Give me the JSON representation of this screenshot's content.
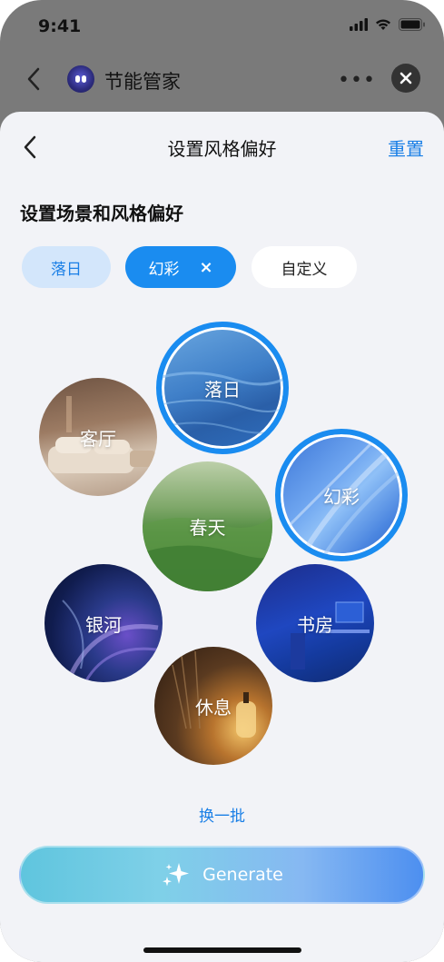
{
  "status_bar": {
    "time": "9:41"
  },
  "app_header": {
    "title": "节能管家"
  },
  "sheet": {
    "title": "设置风格偏好",
    "reset_label": "重置",
    "section_title": "设置场景和风格偏好",
    "chips": [
      {
        "label": "落日",
        "state": "selected-light"
      },
      {
        "label": "幻彩",
        "state": "active",
        "remove": "×"
      },
      {
        "label": "自定义",
        "state": "default"
      }
    ],
    "bubbles": [
      {
        "label": "落日",
        "selected": true
      },
      {
        "label": "客厅",
        "selected": false
      },
      {
        "label": "幻彩",
        "selected": true
      },
      {
        "label": "春天",
        "selected": false
      },
      {
        "label": "银河",
        "selected": false
      },
      {
        "label": "书房",
        "selected": false
      },
      {
        "label": "休息",
        "selected": false
      }
    ],
    "refresh_label": "换一批",
    "generate_label": "Generate"
  },
  "colors": {
    "accent": "#1a8cf0",
    "link": "#1a7fe6",
    "sheet_bg": "#f2f3f7",
    "overlay": "#7a7a7a"
  }
}
